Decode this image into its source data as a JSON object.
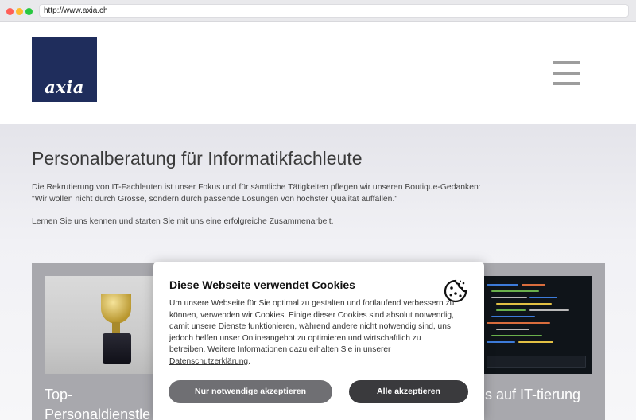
{
  "browser": {
    "url": "http://www.axia.ch"
  },
  "header": {
    "logo_text": "axia"
  },
  "hero": {
    "title": "Personalberatung für Informatikfachleute",
    "paragraph_line1": "Die Rekrutierung von IT-Fachleuten ist unser Fokus und für sämtliche Tätigkeiten pflegen wir unseren Boutique-Gedanken:",
    "paragraph_line2": "\"Wir wollen nicht durch Grösse, sondern durch passende Lösungen von höchster Qualität auffallen.\"",
    "paragraph2": "Lernen Sie uns kennen und starten Sie mit uns eine erfolgreiche Zusammenarbeit."
  },
  "cards": {
    "left_title": "Top-Personaldienstle",
    "right_title": "s auf IT-tierung"
  },
  "cookie_modal": {
    "title": "Diese Webseite verwendet Cookies",
    "text": "Um unsere Webseite für Sie optimal zu gestalten und fortlaufend verbessern zu können, verwenden wir Cookies. Einige dieser Cookies sind absolut notwendig, damit unsere Dienste funktionieren, während andere nicht notwendig sind, uns jedoch helfen unser Onlineangebot zu optimieren und wirtschaftlich zu betreiben. Weitere Informationen dazu erhalten Sie in unserer ",
    "link_label": "Datenschutzerklärung",
    "text_end": ".",
    "btn_necessary": "Nur notwendige akzeptieren",
    "btn_all": "Alle akzeptieren"
  },
  "icons": {
    "cookie": "cookie-icon",
    "menu": "hamburger-menu-icon"
  },
  "colors": {
    "logo_bg": "#1f2d5c",
    "card_bg": "#a8a8ad",
    "btn_necessary": "#6f6f73",
    "btn_all": "#3a3a3d"
  }
}
